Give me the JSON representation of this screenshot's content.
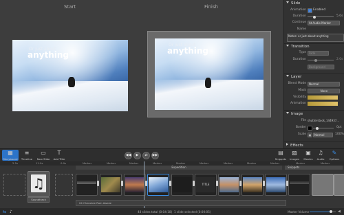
{
  "preview": {
    "start_label": "Start",
    "finish_label": "Finish",
    "slide_small_text": "Or just about",
    "slide_big_text": "anything"
  },
  "inspector": {
    "slide": {
      "title": "Slide",
      "animation_label": "Animation",
      "animation_value": "Enabled",
      "duration_label": "Duration",
      "duration_value": "5.0s",
      "continue_label": "Continue",
      "continue_value": "At Audio Marker",
      "name_label": "Name",
      "notes_value": "Notes: or just about anything"
    },
    "transition": {
      "title": "Transition",
      "type_label": "Type",
      "type_value": "Fade",
      "duration_label": "Duration",
      "duration_value": "2.0s",
      "background_value": "Background"
    },
    "layer": {
      "title": "Layer",
      "blend_label": "Blend Mode",
      "blend_value": "Normal",
      "mask_label": "Mask",
      "mask_value": "None",
      "visibility_label": "Visibility",
      "animation_label": "Animation"
    },
    "image": {
      "title": "Image",
      "file_label": "File",
      "file_value": "shutterstock_144937...",
      "border_label": "Border",
      "border_value": "0pt",
      "scale_label": "Scale",
      "scale_value": "Normal",
      "scale_pct": "100%"
    },
    "effects_title": "Effects"
  },
  "toolbar": {
    "storyboard": "Storyboard",
    "timeline": "Timeline",
    "new_slide": "New Slide",
    "add_title": "Add Title",
    "snippets": "Snippets",
    "images": "Images",
    "movies": "Movies",
    "audio": "Audio",
    "options": "Options"
  },
  "ruler": {
    "left1": "2.2s",
    "left2": "11.0s",
    "left3": "0.0s",
    "markers": [
      "Marker",
      "Marker",
      "Marker",
      "Marker",
      "Marker",
      "Marker",
      "Marker",
      "Marker",
      "Marker",
      "Marker",
      "Marker"
    ]
  },
  "timeline": {
    "group1_label": "Expedition",
    "group2_label": "Snippets",
    "title_clip_label": "TITLE",
    "audio_clip_label": "Soundtrack",
    "audio_track_label": "04 Cherokee Rain Awake"
  },
  "statusbar": {
    "summary": "48 slides total (0:04:18)",
    "selection": "1 slide selected (0:00:05)",
    "master_volume_label": "Master Volume"
  }
}
